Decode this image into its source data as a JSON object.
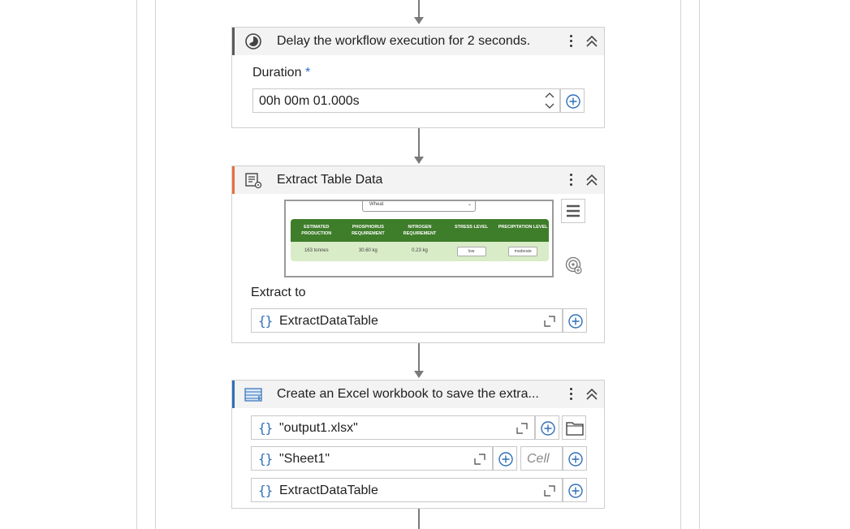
{
  "delay_card": {
    "title": "Delay the workflow execution for 2 seconds.",
    "duration_label": "Duration",
    "required_mark": "*",
    "duration_value": "00h 00m 01.000s"
  },
  "extract_card": {
    "title": "Extract Table Data",
    "extract_to_label": "Extract to",
    "extract_to_value": "ExtractDataTable",
    "preview": {
      "select_text": "Wheat",
      "headers": [
        "ESTIMATED PRODUCTION",
        "PHOSPHORUS REQUIREMENT",
        "NITROGEN REQUIREMENT",
        "STRESS LEVEL",
        "PRECIPITATION LEVEL"
      ],
      "row": [
        "163 tonnes",
        "30.60 kg",
        "0.23 kg",
        "low",
        "moderate"
      ]
    }
  },
  "excel_card": {
    "title": "Create an Excel workbook to save the extra...",
    "file_value": "\"output1.xlsx\"",
    "sheet_value": "\"Sheet1\"",
    "cell_placeholder": "Cell",
    "table_value": "ExtractDataTable"
  },
  "colors": {
    "accent_blue": "#2f6fb8",
    "accent_orange": "#e8703a",
    "table_green": "#3e7d2a"
  }
}
